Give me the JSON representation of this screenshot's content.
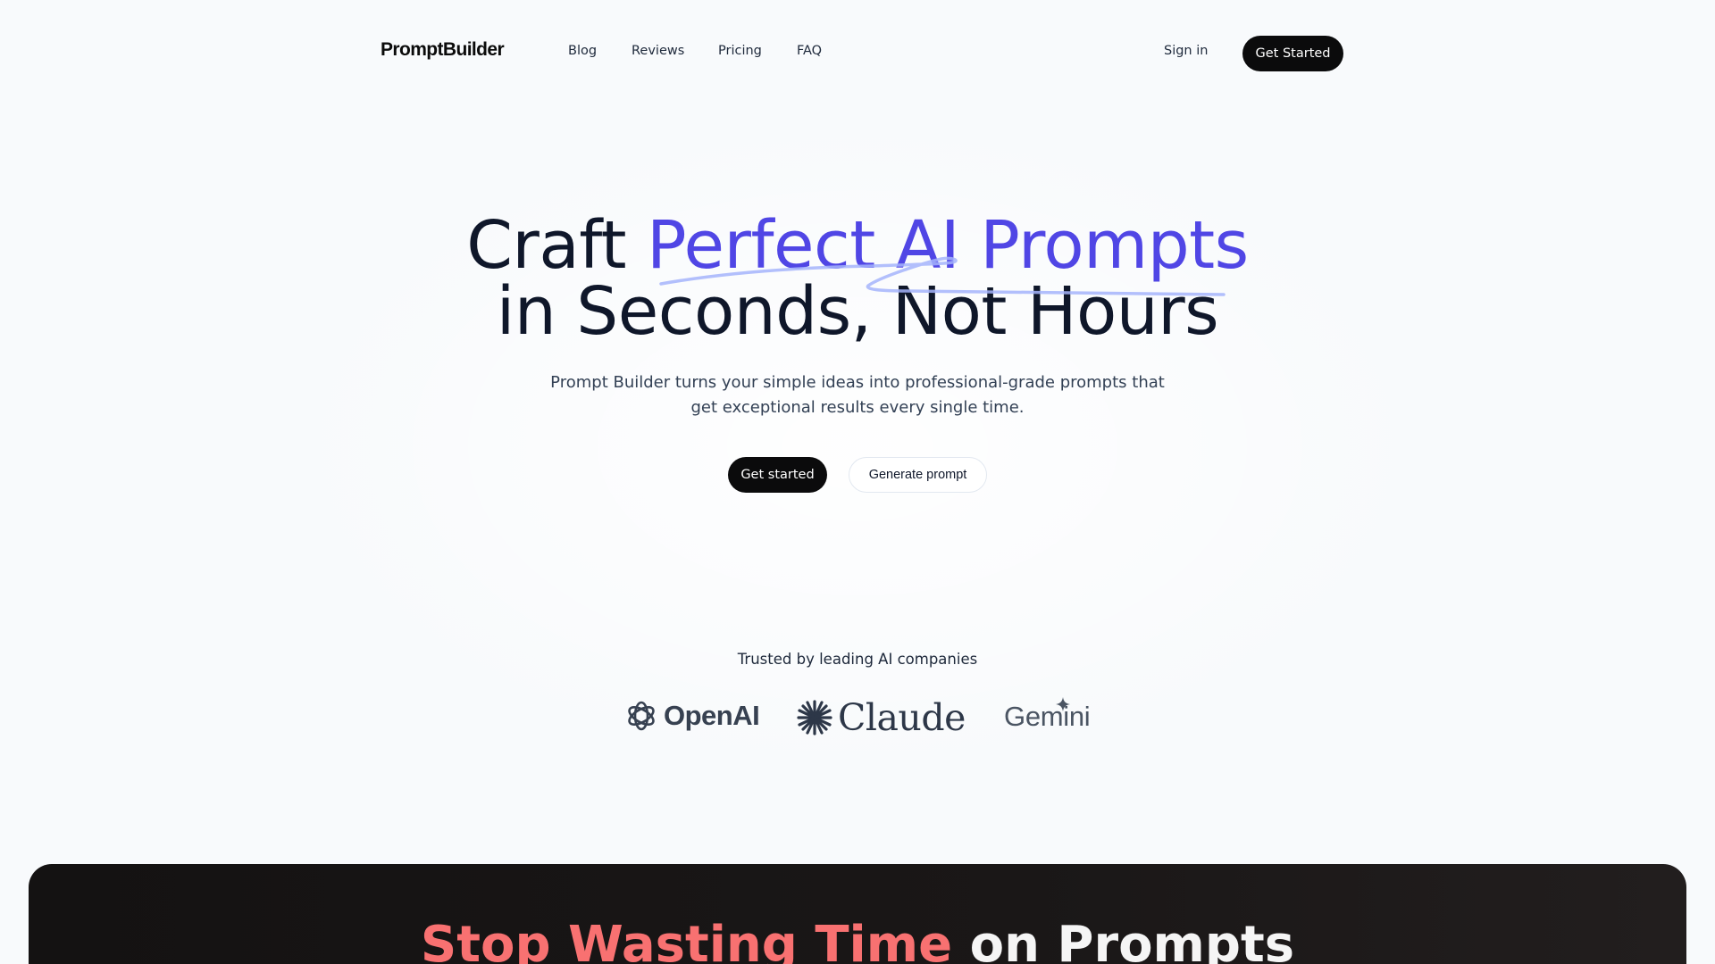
{
  "nav": {
    "logo": "PromptBuilder",
    "links": [
      "Blog",
      "Reviews",
      "Pricing",
      "FAQ"
    ],
    "sign_in": "Sign in",
    "cta": "Get Started"
  },
  "hero": {
    "title_pre": "Craft ",
    "title_accent": "Perfect AI Prompts",
    "title_line2": "in Seconds, Not Hours",
    "subtitle_line1": "Prompt Builder turns your simple ideas into professional-grade prompts that",
    "subtitle_line2": "get exceptional results every single time.",
    "primary_button": "Get started",
    "secondary_button": "Generate prompt"
  },
  "trusted": {
    "label": "Trusted by leading AI companies",
    "logos": [
      "OpenAI",
      "Claude",
      "Gemini"
    ]
  },
  "dark_section": {
    "title_accent": "Stop Wasting Time",
    "title_rest": " on Prompts"
  },
  "colors": {
    "accent": "#5046e5",
    "dark_button": "#0b0b0c",
    "background": "#f8fafc",
    "red_accent": "#f87171"
  }
}
